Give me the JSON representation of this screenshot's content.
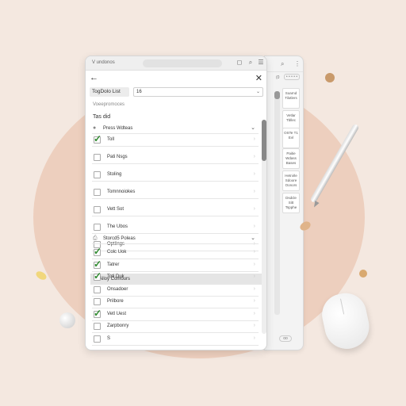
{
  "app": {
    "title": "V undonos"
  },
  "header": {
    "back_icon": "arrow-left-icon",
    "close_icon": "close-icon"
  },
  "form": {
    "label": "TogDolo List",
    "select_value": "16"
  },
  "hint": "Voeepromoces",
  "section_title": "Tas did",
  "groups": [
    {
      "title": "Press Wdteas",
      "items": [
        {
          "label": "Toll",
          "checked": true
        },
        {
          "label": "Pati Nsgs",
          "checked": false
        },
        {
          "label": "Stoling",
          "checked": false
        },
        {
          "label": "Tomnnoiokes",
          "checked": false
        },
        {
          "label": "Vett Sot",
          "checked": false
        },
        {
          "label": "The Ubos",
          "checked": false
        },
        {
          "label": "Optiings",
          "checked": false
        }
      ]
    },
    {
      "title": "Storcd5 Poleas",
      "items": [
        {
          "label": "Colc Uok",
          "checked": true
        },
        {
          "label": "Tatrer",
          "checked": true
        },
        {
          "label": "Toti Duk",
          "checked": true
        },
        {
          "label": "Onsadoer",
          "checked": false
        },
        {
          "label": "Prilbore",
          "checked": false
        },
        {
          "label": "Vetl Uest",
          "checked": true
        },
        {
          "label": "Zarpbonry",
          "checked": false
        },
        {
          "label": "S",
          "checked": false
        }
      ]
    }
  ],
  "highlight_row": "Alloy Comours",
  "side_panel": {
    "radio_label": "(0",
    "dots": "• • • • •",
    "cards": [
      "Soarnd Tilotlers",
      "Vetlar Tbllec",
      "OSTe T1 Evl",
      "Paitie Wdass Bases",
      "Hetnirle Sdoore Oonors",
      "Dsdcle Sitt Tspphe"
    ],
    "bottom_button": "oo"
  },
  "colors": {
    "check": "#2f8a2f",
    "background": "#f4e8e0",
    "blob": "#edcfbe"
  }
}
